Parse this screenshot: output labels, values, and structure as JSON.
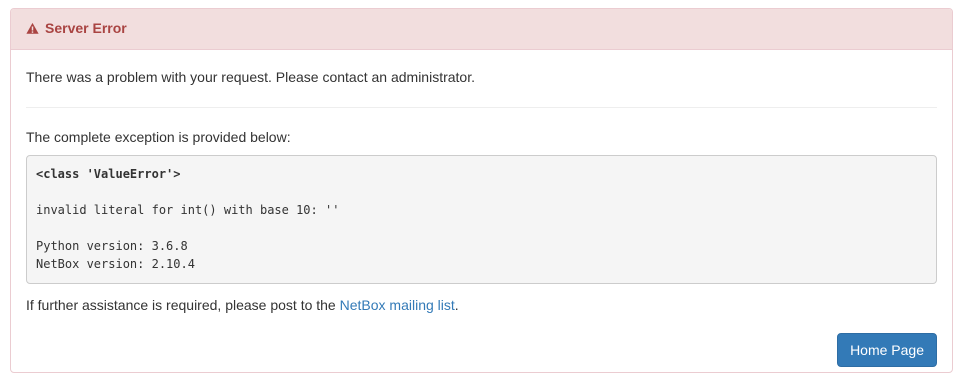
{
  "error_panel": {
    "title": "Server Error",
    "icon": "warning-triangle-icon",
    "colors": {
      "heading_bg": "#f2dede",
      "heading_text": "#a94442",
      "border": "#ebccd1"
    }
  },
  "body": {
    "message": "There was a problem with your request. Please contact an administrator.",
    "exception_label": "The complete exception is provided below:",
    "exception": {
      "class_line": "<class 'ValueError'>",
      "detail": "invalid literal for int() with base 10: ''",
      "python_version": "Python version: 3.6.8",
      "netbox_version": "NetBox version: 2.10.4"
    },
    "assistance_text": "If further assistance is required, please post to the ",
    "mailing_list_link": "NetBox mailing list",
    "assistance_suffix": "."
  },
  "actions": {
    "home_button": "Home Page",
    "button_color": "#337ab7"
  }
}
